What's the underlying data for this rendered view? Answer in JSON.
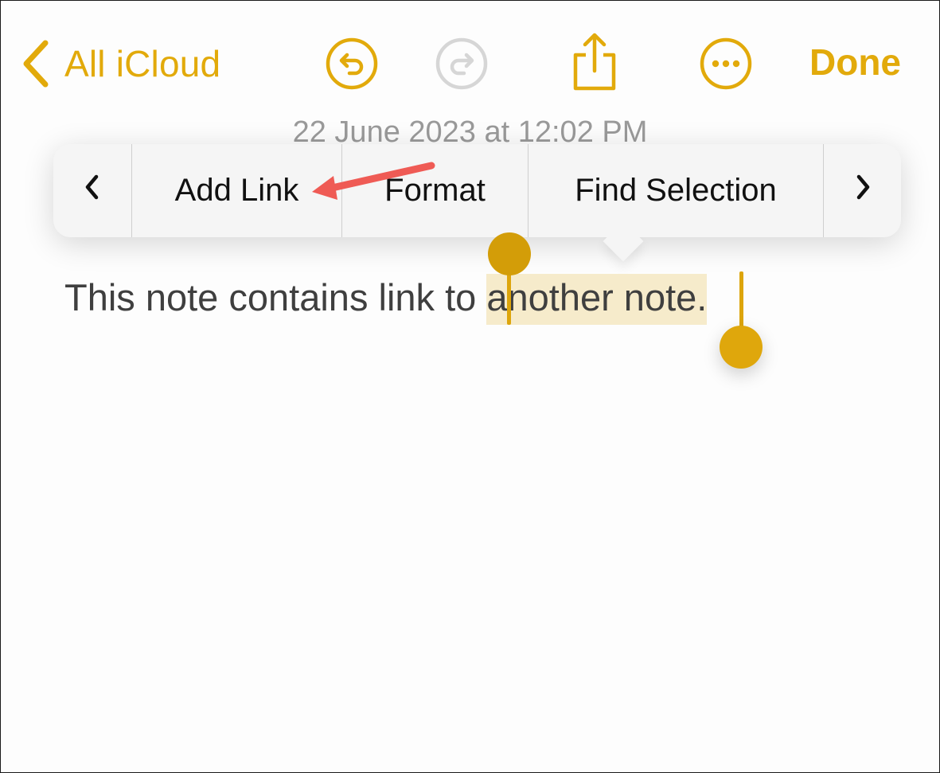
{
  "nav": {
    "back_label": "All iCloud",
    "icons": [
      "chevron-left-icon",
      "undo-icon",
      "redo-icon",
      "share-icon",
      "more-icon"
    ],
    "redo_enabled": false,
    "done_label": "Done",
    "accent_color": "#e2aa0b"
  },
  "note": {
    "date": "22 June 2023 at 12:02 PM",
    "text_before": "This note contains link to ",
    "selected_text": "another note.",
    "selection_color": "#f6ebcb"
  },
  "edit_menu": {
    "prev_glyph": "‹",
    "items": [
      "Add Link",
      "Format",
      "Find Selection"
    ],
    "next_glyph": "›"
  },
  "annotation": {
    "type": "arrow",
    "target": "Add Link",
    "color": "#ef5b55"
  }
}
